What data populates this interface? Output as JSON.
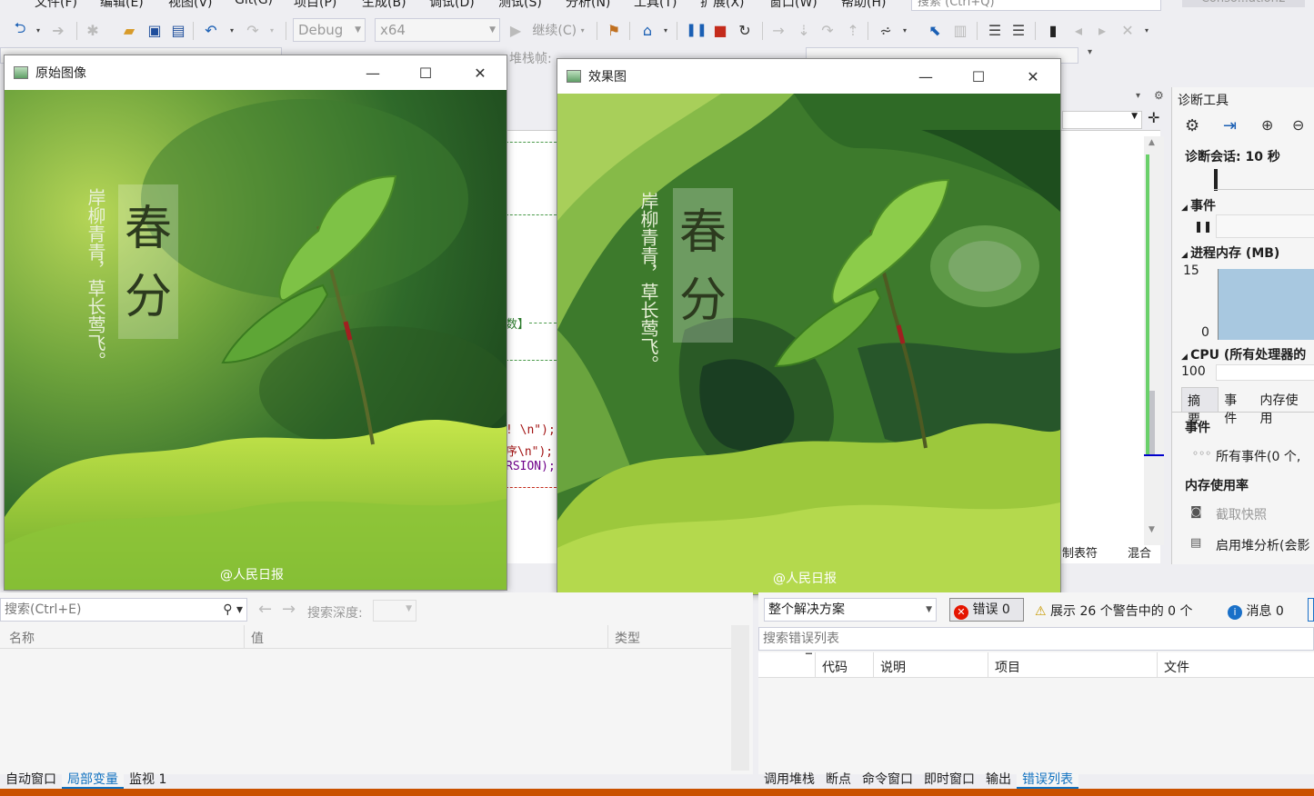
{
  "menu": [
    "文件(F)",
    "编辑(E)",
    "视图(V)",
    "Git(G)",
    "项目(P)",
    "生成(B)",
    "调试(D)",
    "测试(S)",
    "分析(N)",
    "工具(T)",
    "扩展(X)",
    "窗口(W)",
    "帮助(H)"
  ],
  "search_top": "搜索 (Ctrl+Q)",
  "solution_name": "Conso...ation2",
  "toolbar": {
    "config": "Debug",
    "platform": "x64",
    "continue": "继续(C)"
  },
  "toolbar2": {
    "frame_label": "堆栈帧:"
  },
  "code": {
    "line1": "数】",
    "line2": "! \\n\");",
    "line3": "序\\n\");",
    "line4": "RSION);"
  },
  "window_original": {
    "title": "原始图像",
    "watermark": "@人民日报",
    "poem": "岸柳青青，草长莺飞。",
    "title_chars": [
      "春",
      "分"
    ]
  },
  "window_effect": {
    "title": "效果图",
    "watermark": "@人民日报",
    "poem": "岸柳青青，草长莺飞。",
    "title_chars": [
      "春",
      "分"
    ]
  },
  "diagnostics": {
    "title": "诊断工具",
    "session": "诊断会话: 10 秒",
    "events_header": "事件",
    "memory_header": "进程内存 (MB)",
    "mem_max": "15",
    "mem_min": "0",
    "cpu_header": "CPU (所有处理器的",
    "cpu_max": "100",
    "tabs": [
      "摘要",
      "事件",
      "内存使用"
    ],
    "events_section": "事件",
    "all_events": "所有事件(0 个,",
    "memory_usage": "内存使用率",
    "snapshot": "截取快照",
    "heap": "启用堆分析(会影"
  },
  "editor_bottom": {
    "tab_stops": "制表符",
    "mixed": "混合"
  },
  "locals": {
    "search_placeholder": "搜索(Ctrl+E)",
    "search_depth": "搜索深度:",
    "columns": [
      "名称",
      "值",
      "类型"
    ],
    "tabs": [
      "自动窗口",
      "局部变量",
      "监视 1"
    ],
    "active_tab": "局部变量"
  },
  "errors": {
    "scope": "整个解决方案",
    "errors": "错误 0",
    "warnings": "展示 26 个警告中的 0 个",
    "messages": "消息 0",
    "search_placeholder": "搜索错误列表",
    "columns": [
      "代码",
      "说明",
      "项目",
      "文件"
    ],
    "tabs": [
      "调用堆栈",
      "断点",
      "命令窗口",
      "即时窗口",
      "输出",
      "错误列表"
    ],
    "active_tab": "错误列表"
  },
  "colors": {
    "accent": "#0e70c0",
    "status": "#ca5100",
    "error": "#e51400",
    "warning": "#f0c000"
  }
}
